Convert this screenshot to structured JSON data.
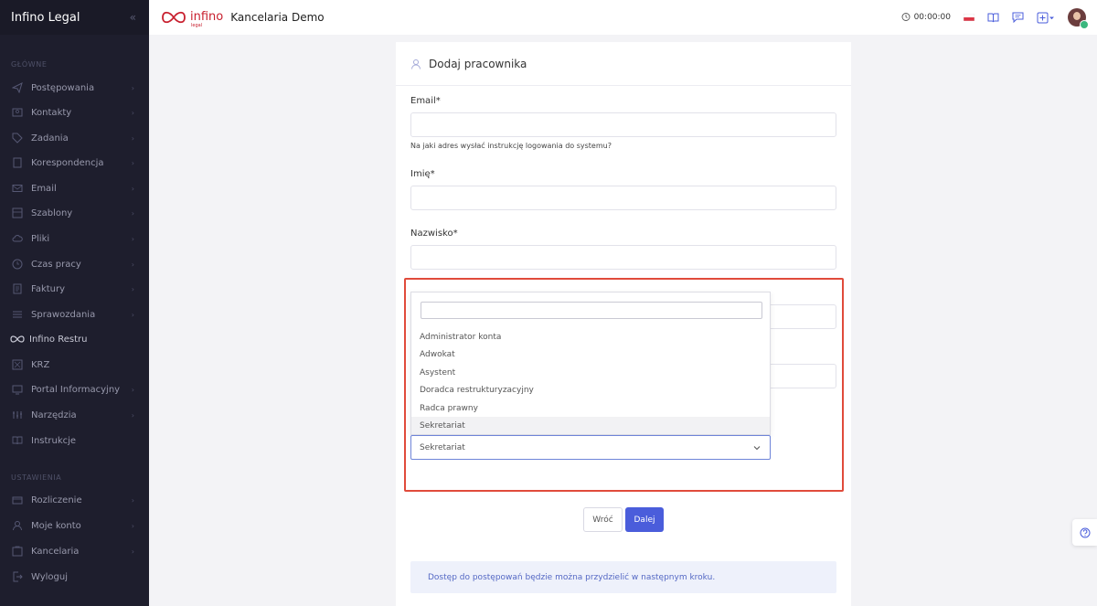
{
  "sidebar": {
    "brand": "Infino Legal",
    "collapse_icon": "double-chevron-left-icon",
    "sections": {
      "main": "GŁÓWNE",
      "settings": "USTAWIENIA"
    },
    "main_items": [
      {
        "label": "Postępowania",
        "icon": "send-icon",
        "chevron": true
      },
      {
        "label": "Kontakty",
        "icon": "contacts-icon",
        "chevron": true
      },
      {
        "label": "Zadania",
        "icon": "tag-icon",
        "chevron": true
      },
      {
        "label": "Korespondencja",
        "icon": "document-icon",
        "chevron": true
      },
      {
        "label": "Email",
        "icon": "mail-icon",
        "chevron": true
      },
      {
        "label": "Szablony",
        "icon": "template-icon",
        "chevron": true
      },
      {
        "label": "Pliki",
        "icon": "cloud-icon",
        "chevron": true
      },
      {
        "label": "Czas pracy",
        "icon": "clock-icon",
        "chevron": true
      },
      {
        "label": "Faktury",
        "icon": "invoice-icon",
        "chevron": true
      },
      {
        "label": "Sprawozdania",
        "icon": "report-icon",
        "chevron": true
      },
      {
        "label": "Infino Restru",
        "icon": "infinity-icon",
        "chevron": false
      },
      {
        "label": "KRZ",
        "icon": "krz-icon",
        "chevron": false
      },
      {
        "label": "Portal Informacyjny",
        "icon": "portal-icon",
        "chevron": true
      },
      {
        "label": "Narzędzia",
        "icon": "tools-icon",
        "chevron": true
      },
      {
        "label": "Instrukcje",
        "icon": "book-icon",
        "chevron": false
      }
    ],
    "settings_items": [
      {
        "label": "Rozliczenie",
        "icon": "billing-icon",
        "chevron": true
      },
      {
        "label": "Moje konto",
        "icon": "user-icon",
        "chevron": true
      },
      {
        "label": "Kancelaria",
        "icon": "office-icon",
        "chevron": true
      },
      {
        "label": "Wyloguj",
        "icon": "logout-icon",
        "chevron": false
      }
    ]
  },
  "header": {
    "logo_text": "infino",
    "logo_sub": "legal",
    "app_title": "Kancelaria Demo",
    "timer": "00:00:00"
  },
  "form": {
    "title": "Dodaj pracownika",
    "email_label": "Email*",
    "email_help": "Na jaki adres wysłać instrukcję logowania do systemu?",
    "first_name_label": "Imię*",
    "last_name_label": "Nazwisko*",
    "role_dropdown": {
      "options": [
        "Administrator konta",
        "Adwokat",
        "Asystent",
        "Doradca restrukturyzacyjny",
        "Radca prawny",
        "Sekretariat"
      ],
      "selected": "Sekretariat"
    },
    "back_label": "Wróć",
    "next_label": "Dalej",
    "info_text": "Dostęp do postępowań będzie można przydzielić w następnym kroku."
  },
  "colors": {
    "sidebar_bg": "#1e1e2d",
    "accent": "#4a5ddb",
    "highlight_border": "#e04b3b",
    "brand_red": "#c8202f"
  }
}
